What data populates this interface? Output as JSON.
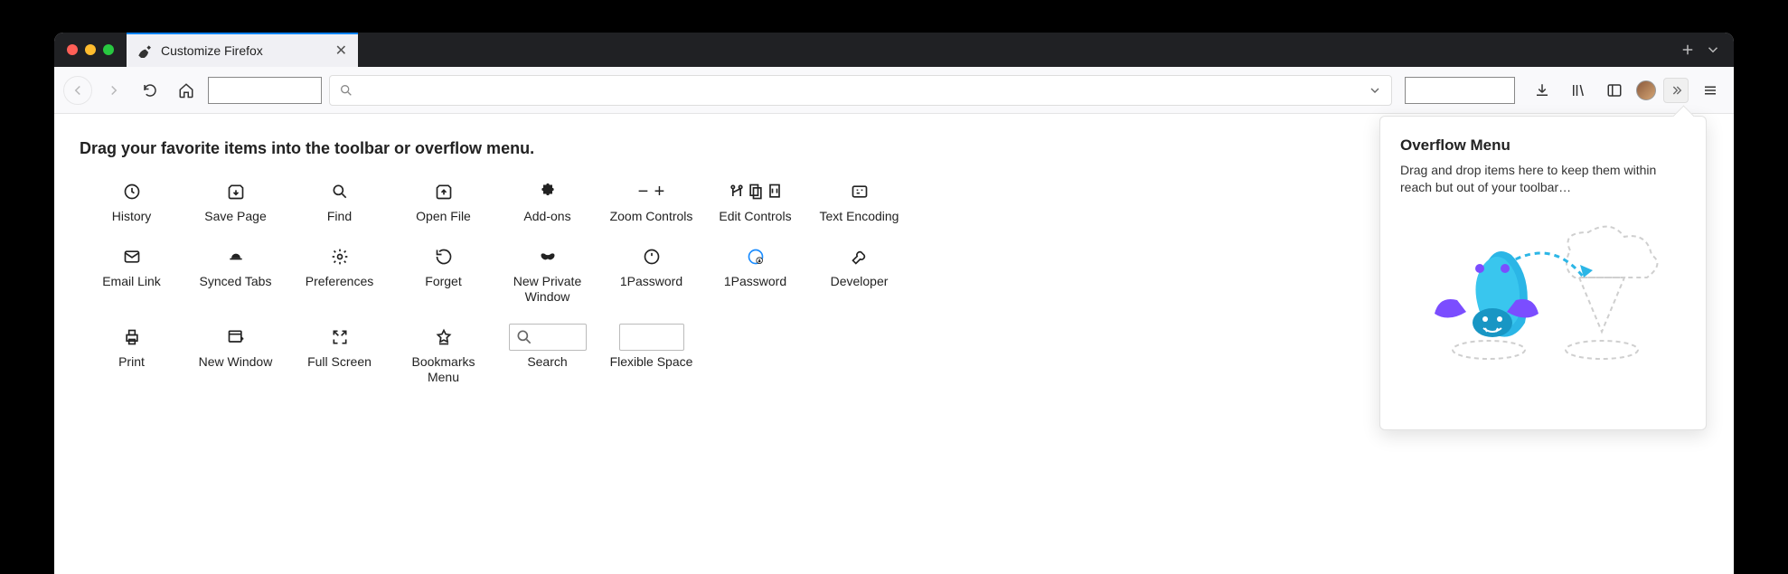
{
  "tab": {
    "title": "Customize Firefox"
  },
  "heading": "Drag your favorite items into the toolbar or overflow menu.",
  "items": [
    {
      "label": "History",
      "icon": "history"
    },
    {
      "label": "Save Page",
      "icon": "save"
    },
    {
      "label": "Find",
      "icon": "search"
    },
    {
      "label": "Open File",
      "icon": "openfile"
    },
    {
      "label": "Add-ons",
      "icon": "puzzle"
    },
    {
      "label": "Zoom Controls",
      "icon": "zoom"
    },
    {
      "label": "Edit Controls",
      "icon": "edit"
    },
    {
      "label": "Text Encoding",
      "icon": "encoding"
    },
    {
      "label": "Email Link",
      "icon": "mail"
    },
    {
      "label": "Synced Tabs",
      "icon": "synced"
    },
    {
      "label": "Preferences",
      "icon": "gear"
    },
    {
      "label": "Forget",
      "icon": "forget"
    },
    {
      "label": "New Private Window",
      "icon": "mask"
    },
    {
      "label": "1Password",
      "icon": "onepw1"
    },
    {
      "label": "1Password",
      "icon": "onepw2"
    },
    {
      "label": "Developer",
      "icon": "wrench"
    },
    {
      "label": "Print",
      "icon": "print"
    },
    {
      "label": "New Window",
      "icon": "newwin"
    },
    {
      "label": "Full Screen",
      "icon": "fullscreen"
    },
    {
      "label": "Bookmarks Menu",
      "icon": "bookmark"
    },
    {
      "label": "Search",
      "icon": "searchbox"
    },
    {
      "label": "Flexible Space",
      "icon": "flexspace"
    }
  ],
  "overflow": {
    "title": "Overflow Menu",
    "desc": "Drag and drop items here to keep them within reach but out of your toolbar…"
  }
}
